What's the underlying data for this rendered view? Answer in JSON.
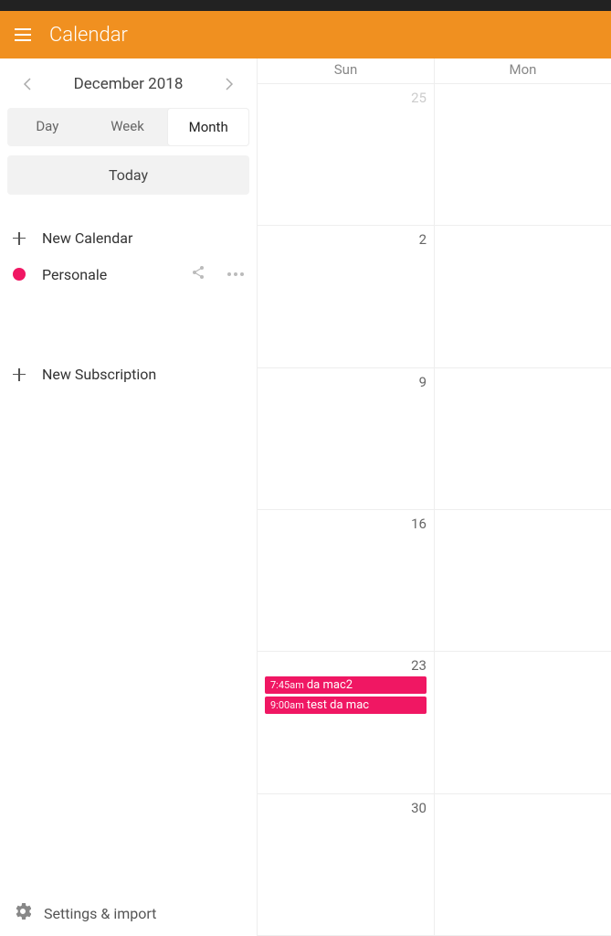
{
  "app": {
    "title": "Calendar"
  },
  "nav": {
    "month_label": "December 2018",
    "views": {
      "day": "Day",
      "week": "Week",
      "month": "Month"
    },
    "today": "Today"
  },
  "sidebar": {
    "new_calendar": "New Calendar",
    "calendars": [
      {
        "name": "Personale",
        "color": "#f01763"
      }
    ],
    "new_subscription": "New Subscription",
    "settings": "Settings & import"
  },
  "grid": {
    "day_headers": [
      "Sun",
      "Mon"
    ],
    "weeks": [
      {
        "days": [
          {
            "num": "25",
            "other": true
          },
          {
            "num": ""
          }
        ]
      },
      {
        "days": [
          {
            "num": "2"
          },
          {
            "num": ""
          }
        ]
      },
      {
        "days": [
          {
            "num": "9"
          },
          {
            "num": ""
          }
        ]
      },
      {
        "days": [
          {
            "num": "16"
          },
          {
            "num": ""
          }
        ]
      },
      {
        "days": [
          {
            "num": "23",
            "events": [
              {
                "time": "7:45am",
                "title": "da mac2"
              },
              {
                "time": "9:00am",
                "title": "test da mac"
              }
            ]
          },
          {
            "num": ""
          }
        ]
      },
      {
        "days": [
          {
            "num": "30"
          },
          {
            "num": ""
          }
        ]
      }
    ]
  }
}
